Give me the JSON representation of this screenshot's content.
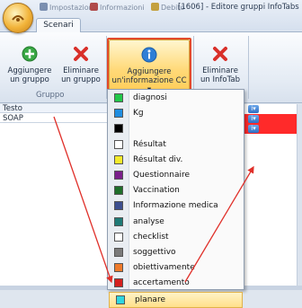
{
  "window": {
    "title": "[1606] - Editore gruppi InfoTabs",
    "qat_items": [
      {
        "label": "Impostazioni",
        "color": "#7b8fb0"
      },
      {
        "label": "Informazioni",
        "color": "#b04b4b"
      },
      {
        "label": "Debito",
        "color": "#c4a13f"
      }
    ]
  },
  "tabs": [
    {
      "label": "Scenari"
    }
  ],
  "ribbon": {
    "group_label": "Gruppo",
    "add_group": {
      "line1": "Aggiungere",
      "line2": "un gruppo"
    },
    "remove_group": {
      "line1": "Eliminare",
      "line2": "un gruppo"
    },
    "add_info": {
      "line1": "Aggiungere",
      "line2": "un'informazione CC ▾"
    },
    "remove_infotab": {
      "line1": "Eliminare",
      "line2": "un InfoTab"
    }
  },
  "grid": {
    "rows": [
      {
        "label": "Testo"
      },
      {
        "label": "SOAP"
      }
    ]
  },
  "dropdown": {
    "items": [
      {
        "label": "diagnosi",
        "color": "#22c84a"
      },
      {
        "label": "Kg",
        "color": "#1f8de0"
      },
      {
        "label": "",
        "color": "#000000"
      },
      {
        "label": "Résultat",
        "color": "#ffffff"
      },
      {
        "label": "Résultat div.",
        "color": "#f3ea2b"
      },
      {
        "label": "Questionnaire",
        "color": "#7a1f8a"
      },
      {
        "label": "Vaccination",
        "color": "#1f6f2a"
      },
      {
        "label": "Informazione medica",
        "color": "#3d4f8f"
      },
      {
        "label": "analyse",
        "color": "#1f7a76"
      },
      {
        "label": "checklist",
        "color": "#ffffff"
      },
      {
        "label": "soggettivo",
        "color": "#7a7a7a"
      },
      {
        "label": "obiettivamente",
        "color": "#ee7a2b"
      },
      {
        "label": "accertamento",
        "color": "#d4201e"
      },
      {
        "label": "planare",
        "color": "#2fd6e0"
      }
    ],
    "selected_index": 13
  }
}
